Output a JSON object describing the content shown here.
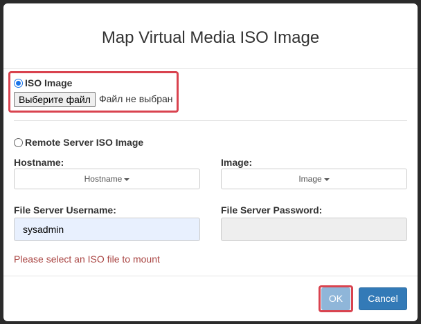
{
  "dialog": {
    "title": "Map Virtual Media ISO Image"
  },
  "iso_option": {
    "label": "ISO Image",
    "selected": true,
    "file_button_label": "Выберите файл",
    "file_status": "Файл не выбран"
  },
  "remote_option": {
    "label": "Remote Server ISO Image",
    "selected": false,
    "hostname_label": "Hostname:",
    "hostname_value": "Hostname",
    "image_label": "Image:",
    "image_value": "Image",
    "username_label": "File Server Username:",
    "username_value": "sysadmin",
    "password_label": "File Server Password:",
    "password_value": ""
  },
  "error_message": "Please select an ISO file to mount",
  "footer": {
    "ok_label": "OK",
    "cancel_label": "Cancel"
  },
  "colors": {
    "highlight": "#d9434f",
    "primary": "#337ab7",
    "error": "#a94442"
  }
}
